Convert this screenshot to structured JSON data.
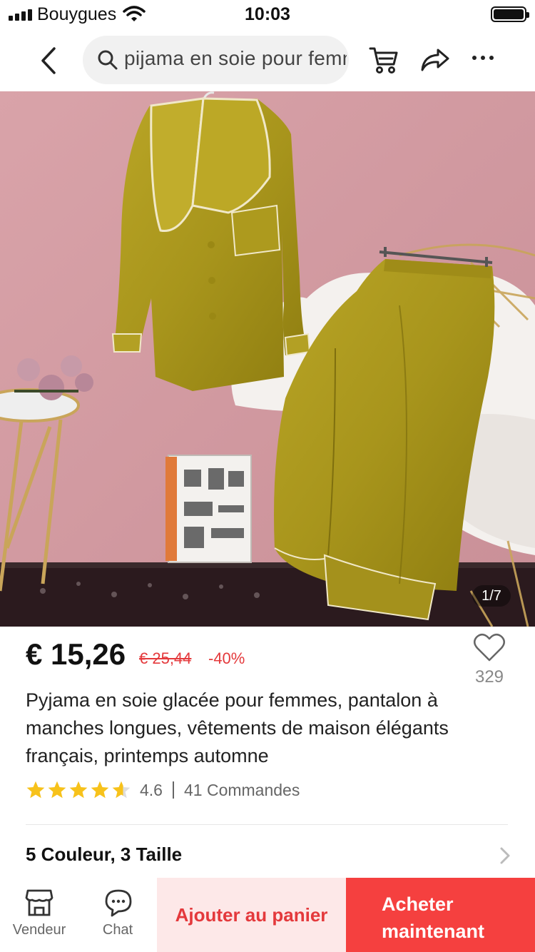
{
  "status_bar": {
    "carrier": "Bouygues",
    "time": "10:03",
    "signal_icon": "signal-icon",
    "wifi_icon": "wifi-icon",
    "battery_icon": "battery-icon"
  },
  "nav": {
    "back_icon": "chevron-left-icon",
    "search_icon": "search-icon",
    "search_query": "pijama en soie pour femme",
    "cart_icon": "cart-icon",
    "share_icon": "share-icon",
    "more_icon": "more-icon"
  },
  "product": {
    "image_counter": "1/7",
    "price": "€ 15,26",
    "original_price": "€ 25,44",
    "discount": "-40%",
    "wishlist_count": "329",
    "title": "Pyjama en soie glacée pour femmes, pantalon à manches longues, vêtements de maison élégants français, printemps automne",
    "rating": 4.6,
    "rating_text": "4.6",
    "orders_text": "41 Commandes",
    "variants_text": "5 Couleur, 3 Taille"
  },
  "bottom_bar": {
    "vendeur_label": "Vendeur",
    "chat_label": "Chat",
    "add_to_cart_label": "Ajouter au panier",
    "buy_now_line1": "Acheter",
    "buy_now_line2": "maintenant"
  },
  "colors": {
    "accent_red": "#e4393c",
    "buy_button": "#f5403f",
    "add_to_cart_bg": "#fde8e8",
    "star": "#f7c21b"
  }
}
